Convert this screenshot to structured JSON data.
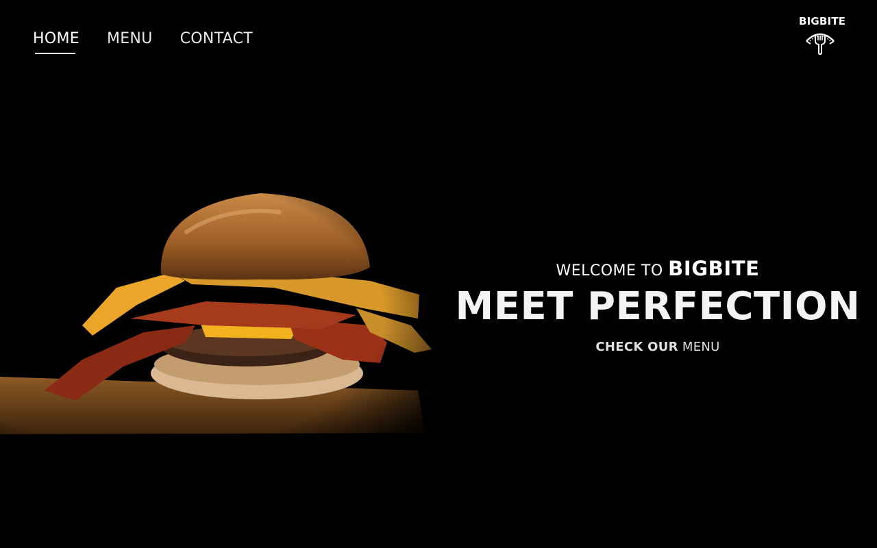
{
  "nav": {
    "items": [
      {
        "label": "HOME",
        "active": true
      },
      {
        "label": "MENU",
        "active": false
      },
      {
        "label": "CONTACT",
        "active": false
      }
    ]
  },
  "logo": {
    "text": "BIGBITE",
    "icon": "fork-arch-icon"
  },
  "hero": {
    "welcome_prefix": "WELCOME TO",
    "welcome_brand": "BIGBITE",
    "headline": "MEET PERFECTION",
    "cta_prefix": "CHECK OUR",
    "cta_link": "MENU"
  },
  "image": {
    "subject": "burger-photo"
  },
  "colors": {
    "background": "#000000",
    "text": "#ffffff",
    "bun": "#b5773a",
    "cheese": "#f2b21e",
    "bacon": "#8a2a14",
    "board": "#7a4a1c"
  }
}
